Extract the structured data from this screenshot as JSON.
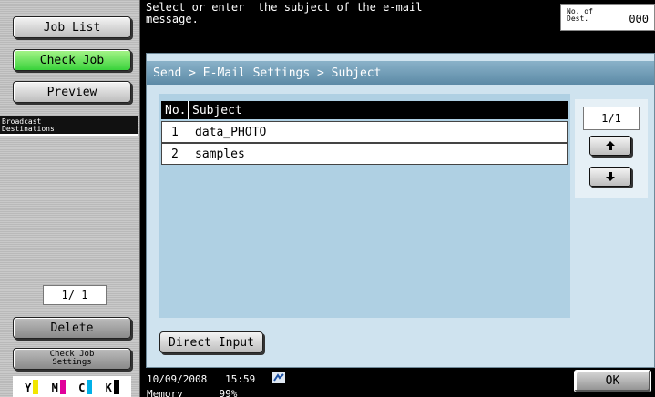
{
  "left_panel": {
    "job_list": "Job List",
    "check_job": "Check Job",
    "preview": "Preview",
    "broadcast_destinations": "Broadcast\nDestinations",
    "page_indicator": "1/ 1",
    "delete": "Delete",
    "check_job_settings_line1": "Check Job",
    "check_job_settings_line2": "Settings",
    "toner": [
      {
        "label": "Y",
        "color": "#f2e600"
      },
      {
        "label": "M",
        "color": "#e0009a"
      },
      {
        "label": "C",
        "color": "#00b0e8"
      },
      {
        "label": "K",
        "color": "#000000"
      }
    ]
  },
  "header": {
    "message": "Select or enter  the subject of the e-mail\nmessage.",
    "dest_label": "No. of\nDest.",
    "dest_count": "000"
  },
  "main": {
    "breadcrumb": "Send > E-Mail Settings > Subject",
    "columns": {
      "no": "No.",
      "subject": "Subject"
    },
    "rows": [
      {
        "no": "1",
        "subject": "data_PHOTO"
      },
      {
        "no": "2",
        "subject": "samples"
      }
    ],
    "scroll_count": "1/1",
    "direct_input": "Direct Input"
  },
  "status": {
    "date": "10/09/2008",
    "time": "15:59",
    "memory_label": "Memory",
    "memory_value": "99%",
    "ok": "OK"
  }
}
